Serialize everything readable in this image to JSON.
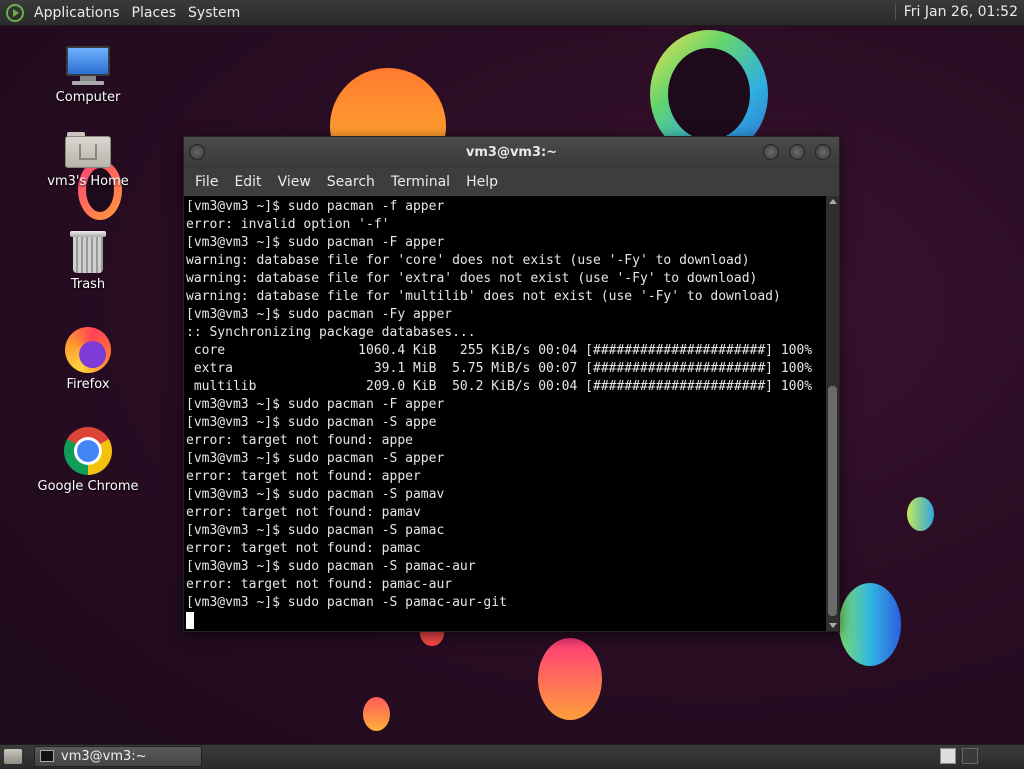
{
  "top_panel": {
    "menus": [
      "Applications",
      "Places",
      "System"
    ],
    "clock": "Fri Jan 26, 01:52",
    "logo_icon": "mate-logo-icon"
  },
  "desktop": {
    "icons": [
      {
        "label": "Computer",
        "icon": "computer-icon"
      },
      {
        "label": "vm3's Home",
        "icon": "home-folder-icon"
      },
      {
        "label": "Trash",
        "icon": "trash-icon"
      },
      {
        "label": "Firefox",
        "icon": "firefox-icon"
      },
      {
        "label": "Google Chrome",
        "icon": "chrome-icon"
      }
    ]
  },
  "window": {
    "title": "vm3@vm3:~",
    "menu": [
      "File",
      "Edit",
      "View",
      "Search",
      "Terminal",
      "Help"
    ],
    "terminal_lines": [
      "[vm3@vm3 ~]$ sudo pacman -f apper",
      "error: invalid option '-f'",
      "[vm3@vm3 ~]$ sudo pacman -F apper",
      "warning: database file for 'core' does not exist (use '-Fy' to download)",
      "warning: database file for 'extra' does not exist (use '-Fy' to download)",
      "warning: database file for 'multilib' does not exist (use '-Fy' to download)",
      "[vm3@vm3 ~]$ sudo pacman -Fy apper",
      ":: Synchronizing package databases...",
      " core                 1060.4 KiB   255 KiB/s 00:04 [######################] 100%",
      " extra                  39.1 MiB  5.75 MiB/s 00:07 [######################] 100%",
      " multilib              209.0 KiB  50.2 KiB/s 00:04 [######################] 100%",
      "[vm3@vm3 ~]$ sudo pacman -F apper",
      "[vm3@vm3 ~]$ sudo pacman -S appe",
      "error: target not found: appe",
      "[vm3@vm3 ~]$ sudo pacman -S apper",
      "error: target not found: apper",
      "[vm3@vm3 ~]$ sudo pacman -S pamav",
      "error: target not found: pamav",
      "[vm3@vm3 ~]$ sudo pacman -S pamac",
      "error: target not found: pamac",
      "[vm3@vm3 ~]$ sudo pacman -S pamac-aur",
      "error: target not found: pamac-aur",
      "[vm3@vm3 ~]$ sudo pacman -S pamac-aur-git"
    ]
  },
  "bottom_panel": {
    "task_label": "vm3@vm3:~"
  },
  "colors": {
    "background": "#2a0d24",
    "panel": "#2f2f2f",
    "terminal_bg": "#000000",
    "terminal_fg": "#e6e6e6"
  }
}
